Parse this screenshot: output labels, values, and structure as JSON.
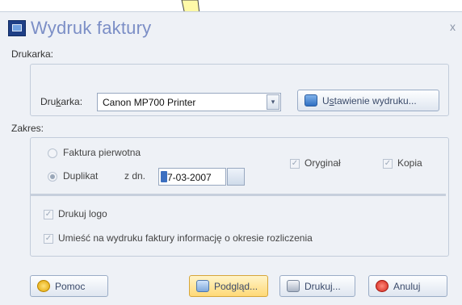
{
  "window": {
    "title": "Wydruk faktury",
    "close_glyph": "x",
    "icon": "app-icon"
  },
  "printer_section": {
    "label": "Drukarka:",
    "field_label_pre": "Dru",
    "field_label_u": "k",
    "field_label_post": "arka:",
    "selected_printer": "Canon MP700 Printer",
    "dropdown_glyph": "▾",
    "setup_button": {
      "label_pre": "U",
      "label_u": "s",
      "label_post": "tawienie wydruku...",
      "icon": "printer-setup-icon"
    }
  },
  "range_section": {
    "label": "Zakres:",
    "option_original": "Faktura pierwotna",
    "option_duplicate": "Duplikat",
    "date_prefix": "z dn.",
    "date_value": "7-03-2007",
    "selected_option": "Duplikat",
    "copy_original": "Oryginał",
    "copy_copy": "Kopia",
    "check_glyph": "✓"
  },
  "options": {
    "print_logo": "Drukuj logo",
    "print_period_info": "Umieść na wydruku faktury informację o okresie rozliczenia"
  },
  "buttons": {
    "help": "Pomoc",
    "preview": "Podgląd...",
    "print": "Drukuj...",
    "cancel": "Anuluj"
  },
  "colors": {
    "title_text": "#7b8ec6",
    "dialog_bg": "#eef1f6",
    "primary_button": "#ffd977",
    "callout_fill": "#fff9a8"
  }
}
